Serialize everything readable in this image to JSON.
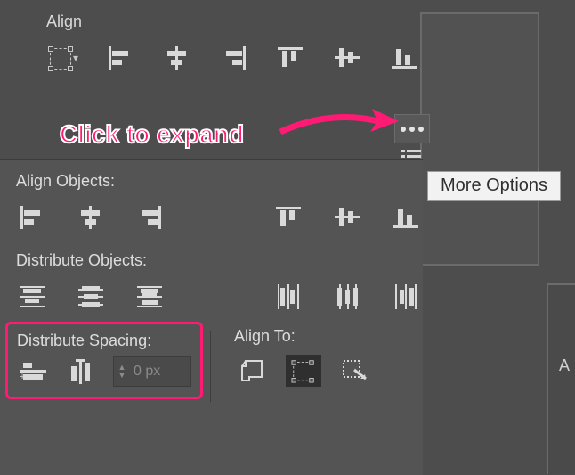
{
  "annotation": {
    "text": "Click to expand"
  },
  "tooltip": {
    "label": "More Options"
  },
  "top_panel": {
    "title": "Align",
    "buttons": [
      {
        "name": "bounding-box-dropdown"
      },
      {
        "name": "align-left"
      },
      {
        "name": "align-hcenter"
      },
      {
        "name": "align-right"
      },
      {
        "name": "align-top"
      },
      {
        "name": "align-vcenter"
      },
      {
        "name": "align-bottom"
      }
    ]
  },
  "expanded": {
    "align_objects": {
      "title": "Align Objects:",
      "buttons": [
        {
          "name": "align-left"
        },
        {
          "name": "align-hcenter"
        },
        {
          "name": "align-right"
        },
        {
          "name": "align-top"
        },
        {
          "name": "align-vcenter"
        },
        {
          "name": "align-bottom"
        }
      ]
    },
    "distribute_objects": {
      "title": "Distribute Objects:",
      "buttons": [
        {
          "name": "vdist-top"
        },
        {
          "name": "vdist-center"
        },
        {
          "name": "vdist-bottom"
        },
        {
          "name": "hdist-left"
        },
        {
          "name": "hdist-center"
        },
        {
          "name": "hdist-right"
        }
      ]
    },
    "distribute_spacing": {
      "title": "Distribute Spacing:",
      "value": "0 px",
      "buttons": [
        {
          "name": "vspace"
        },
        {
          "name": "hspace"
        }
      ]
    },
    "align_to": {
      "title": "Align To:",
      "buttons": [
        {
          "name": "align-to-artboard",
          "selected": false
        },
        {
          "name": "align-to-selection",
          "selected": true
        },
        {
          "name": "align-to-key",
          "selected": false
        }
      ]
    }
  },
  "side": {
    "letter": "A"
  }
}
